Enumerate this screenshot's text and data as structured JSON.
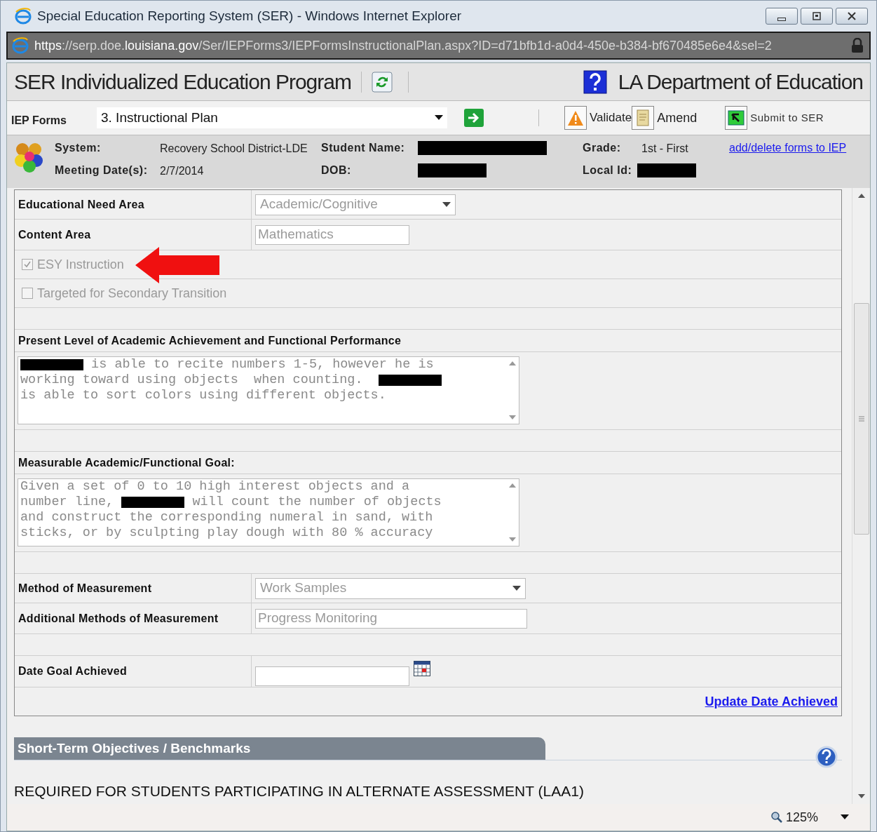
{
  "window": {
    "title": "Special Education Reporting System (SER) - Windows Internet Explorer"
  },
  "address_bar": {
    "url_prefix": "https://serp.doe.",
    "url_domain": "louisiana.gov",
    "url_path": "/Ser/IEPForms3/IEPFormsInstructionalPlan.aspx?ID=d71bfb1d-a0d4-450e-b384-bf670485e6e4&sel=2"
  },
  "header": {
    "title": "SER Individualized Education Program",
    "org": "LA Department of Education"
  },
  "toolbar": {
    "label": "IEP Forms",
    "form_select": "3. Instructional Plan",
    "buttons": [
      {
        "label": "Validate",
        "kind": "validate"
      },
      {
        "label": "Amend",
        "kind": "amend"
      },
      {
        "label": "Submit to SER",
        "kind": "submit"
      }
    ]
  },
  "student_info": {
    "system_label": "System:",
    "system": "Recovery School District-LDE",
    "student_label": "Student Name:",
    "grade_label": "Grade:",
    "grade": "1st - First",
    "forms_link": "add/delete forms to IEP",
    "meeting_label": "Meeting Date(s):",
    "meeting": "2/7/2014",
    "dob_label": "DOB:",
    "local_id_label": "Local Id:"
  },
  "form_rows": [
    {
      "kind": "select",
      "label": "Educational Need Area",
      "value": "Academic/Cognitive"
    },
    {
      "kind": "input",
      "label": "Content Area",
      "value": "Mathematics"
    },
    {
      "kind": "checkbox",
      "label": "ESY Instruction",
      "checked": true,
      "arrow": true
    },
    {
      "kind": "checkbox",
      "label": "Targeted for Secondary Transition",
      "checked": false,
      "arrow": false
    },
    {
      "kind": "blank"
    },
    {
      "kind": "heading",
      "label": "Present Level of Academic Achievement and Functional Performance"
    },
    {
      "kind": "textarea",
      "lines": [
        [
          {
            "kind": "redacted"
          },
          {
            "kind": "text",
            "text": " is able to recite numbers 1-5, however he is"
          }
        ],
        [
          {
            "kind": "text",
            "text": "working toward using objects  when counting.  "
          },
          {
            "kind": "redacted"
          }
        ],
        [
          {
            "kind": "text",
            "text": "is able to sort colors using different objects."
          }
        ]
      ]
    },
    {
      "kind": "blank"
    },
    {
      "kind": "heading",
      "label": "Measurable Academic/Functional Goal:"
    },
    {
      "kind": "textarea",
      "lines": [
        [
          {
            "kind": "text",
            "text": "Given a set of 0 to 10 high interest objects and a"
          }
        ],
        [
          {
            "kind": "text",
            "text": "number line, "
          },
          {
            "kind": "redacted"
          },
          {
            "kind": "text",
            "text": " will count the number of objects"
          }
        ],
        [
          {
            "kind": "text",
            "text": "and construct the corresponding numeral in sand, with"
          }
        ],
        [
          {
            "kind": "text",
            "text": "sticks, or by sculpting play dough with 80 % accuracy"
          }
        ]
      ]
    },
    {
      "kind": "blank"
    },
    {
      "kind": "select",
      "label": "Method of Measurement",
      "value": "Work Samples",
      "wide": true
    },
    {
      "kind": "input",
      "label": "Additional Methods of Measurement",
      "value": "Progress Monitoring",
      "wide": true
    },
    {
      "kind": "blank"
    },
    {
      "kind": "date",
      "label": "Date Goal Achieved"
    },
    {
      "kind": "link",
      "label": "Update Date Achieved"
    }
  ],
  "section": {
    "title": "Short-Term Objectives / Benchmarks",
    "note": "REQUIRED FOR STUDENTS PARTICIPATING IN ALTERNATE ASSESSMENT (LAA1)"
  },
  "status_bar": {
    "zoom": "125%"
  }
}
